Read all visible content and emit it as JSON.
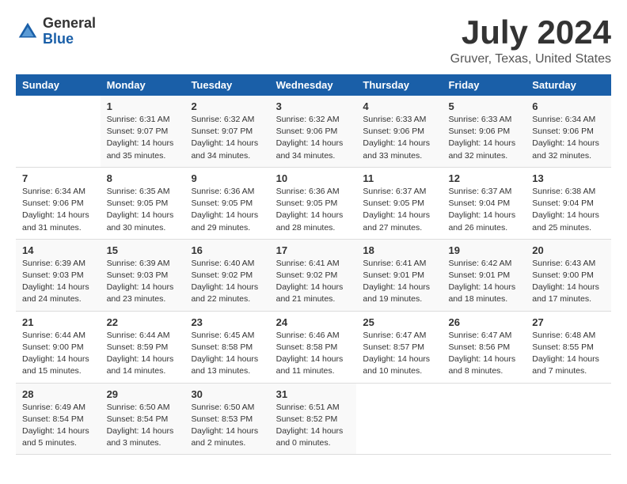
{
  "logo": {
    "general": "General",
    "blue": "Blue"
  },
  "title": {
    "month_year": "July 2024",
    "location": "Gruver, Texas, United States"
  },
  "days_of_week": [
    "Sunday",
    "Monday",
    "Tuesday",
    "Wednesday",
    "Thursday",
    "Friday",
    "Saturday"
  ],
  "weeks": [
    [
      {
        "day": "",
        "info": ""
      },
      {
        "day": "1",
        "info": "Sunrise: 6:31 AM\nSunset: 9:07 PM\nDaylight: 14 hours\nand 35 minutes."
      },
      {
        "day": "2",
        "info": "Sunrise: 6:32 AM\nSunset: 9:07 PM\nDaylight: 14 hours\nand 34 minutes."
      },
      {
        "day": "3",
        "info": "Sunrise: 6:32 AM\nSunset: 9:06 PM\nDaylight: 14 hours\nand 34 minutes."
      },
      {
        "day": "4",
        "info": "Sunrise: 6:33 AM\nSunset: 9:06 PM\nDaylight: 14 hours\nand 33 minutes."
      },
      {
        "day": "5",
        "info": "Sunrise: 6:33 AM\nSunset: 9:06 PM\nDaylight: 14 hours\nand 32 minutes."
      },
      {
        "day": "6",
        "info": "Sunrise: 6:34 AM\nSunset: 9:06 PM\nDaylight: 14 hours\nand 32 minutes."
      }
    ],
    [
      {
        "day": "7",
        "info": "Sunrise: 6:34 AM\nSunset: 9:06 PM\nDaylight: 14 hours\nand 31 minutes."
      },
      {
        "day": "8",
        "info": "Sunrise: 6:35 AM\nSunset: 9:05 PM\nDaylight: 14 hours\nand 30 minutes."
      },
      {
        "day": "9",
        "info": "Sunrise: 6:36 AM\nSunset: 9:05 PM\nDaylight: 14 hours\nand 29 minutes."
      },
      {
        "day": "10",
        "info": "Sunrise: 6:36 AM\nSunset: 9:05 PM\nDaylight: 14 hours\nand 28 minutes."
      },
      {
        "day": "11",
        "info": "Sunrise: 6:37 AM\nSunset: 9:05 PM\nDaylight: 14 hours\nand 27 minutes."
      },
      {
        "day": "12",
        "info": "Sunrise: 6:37 AM\nSunset: 9:04 PM\nDaylight: 14 hours\nand 26 minutes."
      },
      {
        "day": "13",
        "info": "Sunrise: 6:38 AM\nSunset: 9:04 PM\nDaylight: 14 hours\nand 25 minutes."
      }
    ],
    [
      {
        "day": "14",
        "info": "Sunrise: 6:39 AM\nSunset: 9:03 PM\nDaylight: 14 hours\nand 24 minutes."
      },
      {
        "day": "15",
        "info": "Sunrise: 6:39 AM\nSunset: 9:03 PM\nDaylight: 14 hours\nand 23 minutes."
      },
      {
        "day": "16",
        "info": "Sunrise: 6:40 AM\nSunset: 9:02 PM\nDaylight: 14 hours\nand 22 minutes."
      },
      {
        "day": "17",
        "info": "Sunrise: 6:41 AM\nSunset: 9:02 PM\nDaylight: 14 hours\nand 21 minutes."
      },
      {
        "day": "18",
        "info": "Sunrise: 6:41 AM\nSunset: 9:01 PM\nDaylight: 14 hours\nand 19 minutes."
      },
      {
        "day": "19",
        "info": "Sunrise: 6:42 AM\nSunset: 9:01 PM\nDaylight: 14 hours\nand 18 minutes."
      },
      {
        "day": "20",
        "info": "Sunrise: 6:43 AM\nSunset: 9:00 PM\nDaylight: 14 hours\nand 17 minutes."
      }
    ],
    [
      {
        "day": "21",
        "info": "Sunrise: 6:44 AM\nSunset: 9:00 PM\nDaylight: 14 hours\nand 15 minutes."
      },
      {
        "day": "22",
        "info": "Sunrise: 6:44 AM\nSunset: 8:59 PM\nDaylight: 14 hours\nand 14 minutes."
      },
      {
        "day": "23",
        "info": "Sunrise: 6:45 AM\nSunset: 8:58 PM\nDaylight: 14 hours\nand 13 minutes."
      },
      {
        "day": "24",
        "info": "Sunrise: 6:46 AM\nSunset: 8:58 PM\nDaylight: 14 hours\nand 11 minutes."
      },
      {
        "day": "25",
        "info": "Sunrise: 6:47 AM\nSunset: 8:57 PM\nDaylight: 14 hours\nand 10 minutes."
      },
      {
        "day": "26",
        "info": "Sunrise: 6:47 AM\nSunset: 8:56 PM\nDaylight: 14 hours\nand 8 minutes."
      },
      {
        "day": "27",
        "info": "Sunrise: 6:48 AM\nSunset: 8:55 PM\nDaylight: 14 hours\nand 7 minutes."
      }
    ],
    [
      {
        "day": "28",
        "info": "Sunrise: 6:49 AM\nSunset: 8:54 PM\nDaylight: 14 hours\nand 5 minutes."
      },
      {
        "day": "29",
        "info": "Sunrise: 6:50 AM\nSunset: 8:54 PM\nDaylight: 14 hours\nand 3 minutes."
      },
      {
        "day": "30",
        "info": "Sunrise: 6:50 AM\nSunset: 8:53 PM\nDaylight: 14 hours\nand 2 minutes."
      },
      {
        "day": "31",
        "info": "Sunrise: 6:51 AM\nSunset: 8:52 PM\nDaylight: 14 hours\nand 0 minutes."
      },
      {
        "day": "",
        "info": ""
      },
      {
        "day": "",
        "info": ""
      },
      {
        "day": "",
        "info": ""
      }
    ]
  ]
}
